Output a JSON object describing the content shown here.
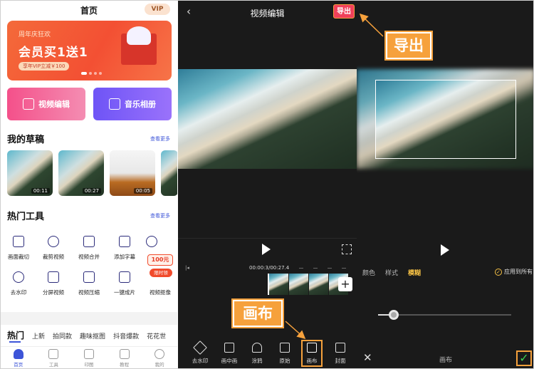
{
  "left_panel": {
    "title": "首页",
    "vip": "VIP",
    "banner": {
      "line1": "周年庆狂欢",
      "line2": "会员买1送1",
      "line3": "享年VIP立减￥100"
    },
    "quick": {
      "video_edit": "视频编辑",
      "music_album": "音乐相册"
    },
    "drafts_title": "我的草稿",
    "see_more": "查看更多",
    "drafts": [
      {
        "duration": "00:11"
      },
      {
        "duration": "00:27"
      },
      {
        "duration": "00:05"
      }
    ],
    "tools_title": "热门工具",
    "tools": [
      "画面裁切",
      "裁剪视频",
      "视频合并",
      "添加字幕",
      "去水印",
      "分屏视频",
      "视频压缩",
      "一键成片",
      "视频抠像"
    ],
    "promo": {
      "amount": "100元",
      "action": "限时领"
    },
    "hot_tabs": [
      "热门",
      "上新",
      "拍同款",
      "趣味抠图",
      "抖音爆款",
      "花花世"
    ],
    "nav": [
      "首页",
      "工具",
      "印图",
      "教程",
      "我的"
    ]
  },
  "middle_panel": {
    "back": "‹",
    "title": "视频编辑",
    "export": "导出",
    "timecode_start": "00:00",
    "timecode": "00:00:3/00:27.4",
    "toolbar": [
      "去水印",
      "画中画",
      "涂鸦",
      "原始",
      "画布",
      "封面"
    ]
  },
  "right_panel": {
    "tabs": [
      "颜色",
      "样式",
      "模糊"
    ],
    "active_tab": "模糊",
    "apply_all": "应用到所有",
    "blur_level": 0.12,
    "bottom_title": "画布",
    "close": "✕",
    "confirm": "✓"
  },
  "annotations": {
    "export": "导出",
    "canvas": "画布"
  },
  "colors": {
    "accent": "#f6a13c",
    "export_btn": "#f0405a",
    "link": "#3d55d8",
    "active_tab": "#f6c145"
  }
}
